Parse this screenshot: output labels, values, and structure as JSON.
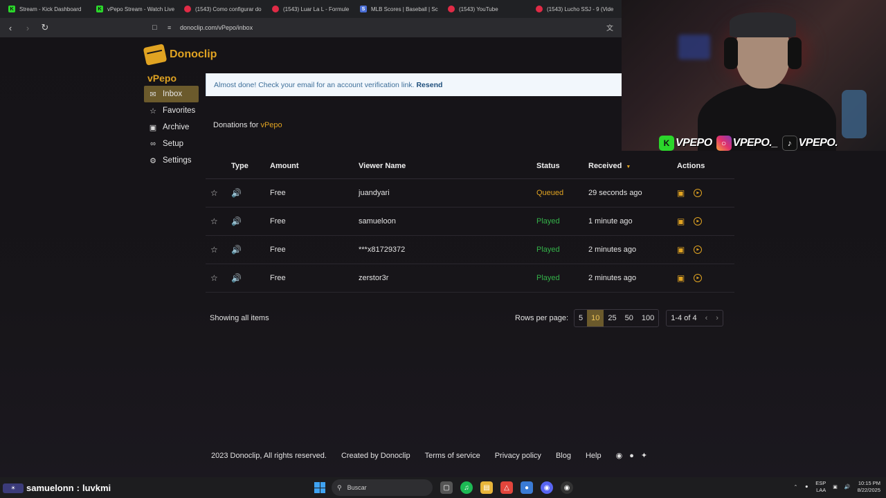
{
  "browser": {
    "tabs": [
      {
        "title": "Stream - Kick Dashboard",
        "icon": "kick-icon",
        "color": "#2bd62b"
      },
      {
        "title": "vPepo Stream - Watch Live",
        "icon": "kick-icon",
        "color": "#2bd62b"
      },
      {
        "title": "(1543) Como configurar do",
        "icon": "youtube-icon",
        "color": "#e02b46"
      },
      {
        "title": "(1543) Luar La L - Formule",
        "icon": "youtube-icon",
        "color": "#e02b46"
      },
      {
        "title": "MLB Scores | Baseball | Sc",
        "icon": "mlb-icon",
        "color": "#4b6fd6"
      },
      {
        "title": "(1543) YouTube",
        "icon": "youtube-icon",
        "color": "#e02b46"
      },
      {
        "title": "(1543) Lucho SSJ - 9 (Vide",
        "icon": "youtube-icon",
        "color": "#e02b46"
      }
    ],
    "url": "donoclip.com/vPepo/inbox"
  },
  "brand": {
    "name": "Donoclip",
    "accent": "#e0a322"
  },
  "profile": {
    "name": "vPepo"
  },
  "sidebar": {
    "items": [
      {
        "label": "Inbox",
        "icon": "inbox-icon"
      },
      {
        "label": "Favorites",
        "icon": "star-icon"
      },
      {
        "label": "Archive",
        "icon": "archive-icon"
      },
      {
        "label": "Setup",
        "icon": "link-icon"
      },
      {
        "label": "Settings",
        "icon": "gear-icon"
      }
    ]
  },
  "alert": {
    "message": "Almost done! Check your email for an account verification link.",
    "action": "Resend"
  },
  "donations": {
    "prefix": "Donations for",
    "user": "vPepo"
  },
  "table": {
    "headers": {
      "type": "Type",
      "amount": "Amount",
      "viewer": "Viewer Name",
      "status": "Status",
      "received": "Received",
      "actions": "Actions"
    },
    "rows": [
      {
        "amount": "Free",
        "viewer": "juandyari",
        "status": "Queued",
        "received": "29 seconds ago"
      },
      {
        "amount": "Free",
        "viewer": "samueloon",
        "status": "Played",
        "received": "1 minute ago"
      },
      {
        "amount": "Free",
        "viewer": "***x81729372",
        "status": "Played",
        "received": "2 minutes ago"
      },
      {
        "amount": "Free",
        "viewer": "zerstor3r",
        "status": "Played",
        "received": "2 minutes ago"
      }
    ],
    "showing": "Showing all items",
    "rows_per_page_label": "Rows per page:",
    "rows_per_page_options": [
      "5",
      "10",
      "25",
      "50",
      "100"
    ],
    "rows_per_page_selected": "10",
    "range": "1-4 of 4"
  },
  "footer": {
    "copyright": "2023 Donoclip, All rights reserved.",
    "created_by": "Created by Donoclip",
    "terms": "Terms of service",
    "privacy": "Privacy policy",
    "blog": "Blog",
    "help": "Help"
  },
  "overlay": {
    "socials": [
      "VPEPO",
      "VPEPO._",
      "VPEPO."
    ],
    "chat": {
      "user": "samuelonn",
      "message": "luvkmi"
    }
  },
  "taskbar": {
    "search_placeholder": "Buscar",
    "lang_top": "ESP",
    "lang_bottom": "LAA",
    "time": "10:15 PM",
    "date": "8/22/2025"
  },
  "status_colors": {
    "queued": "#e0a322",
    "played": "#34b249"
  }
}
